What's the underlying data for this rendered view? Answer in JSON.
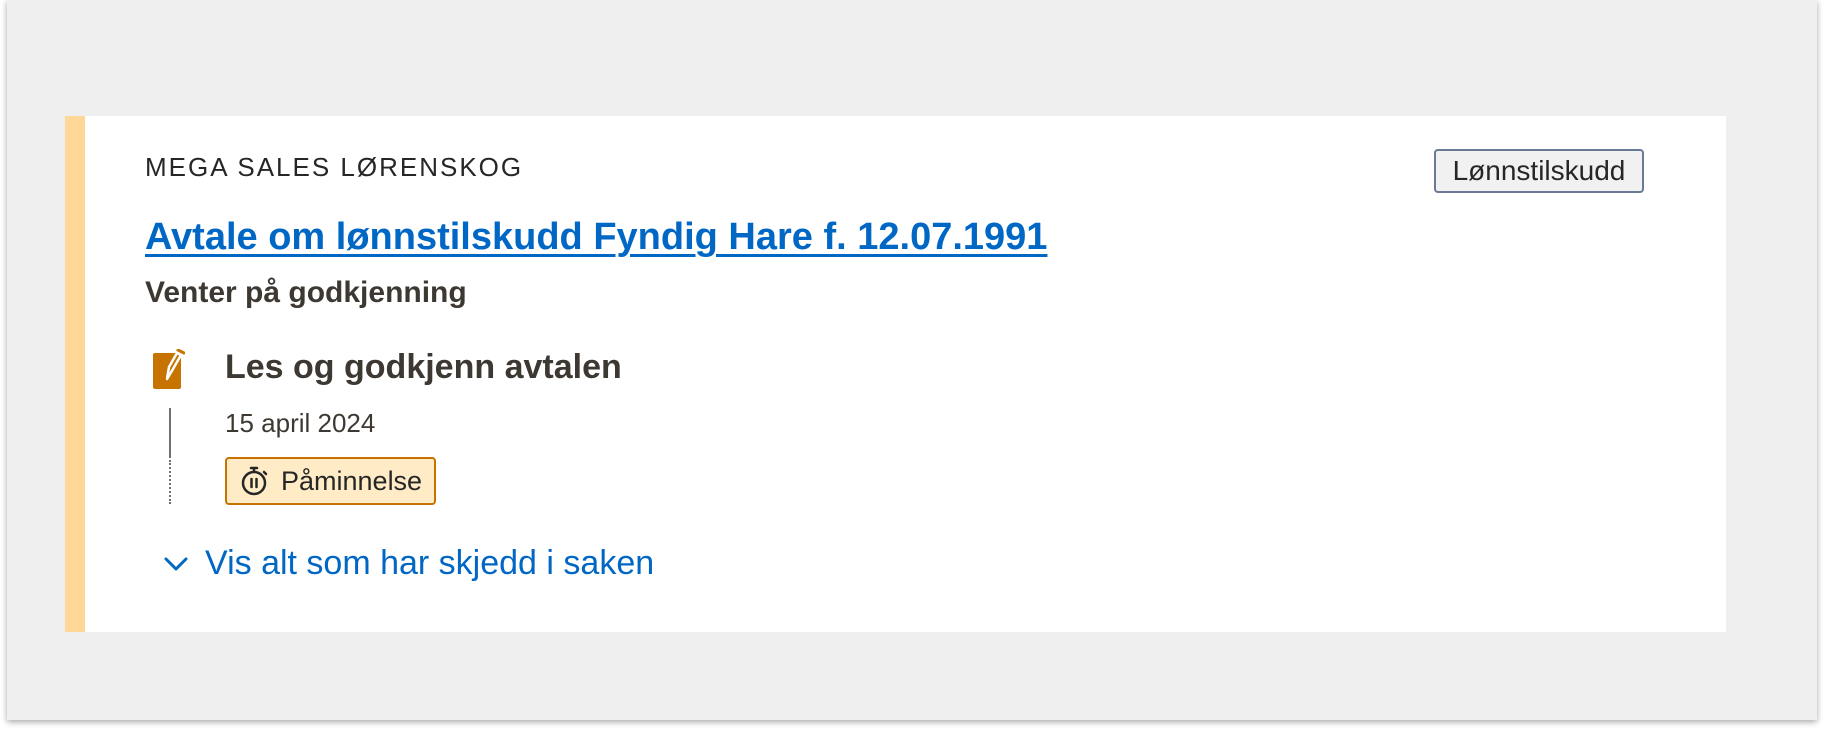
{
  "card": {
    "company": "MEGA SALES LØRENSKOG",
    "type_tag": "Lønnstilskudd",
    "title": "Avtale om lønnstilskudd Fyndig Hare f. 12.07.1991",
    "status": "Venter på godkjenning",
    "accent_color": "#ffd799"
  },
  "task": {
    "title": "Les og godkjenn avtalen",
    "date": "15 april 2024",
    "icon": "edit-document-icon",
    "icon_color": "#c77300"
  },
  "reminder": {
    "label": "Påminnelse",
    "icon": "stopwatch-pause-icon"
  },
  "expand": {
    "label": "Vis alt som har skjedd i saken",
    "icon": "chevron-down-icon"
  },
  "colors": {
    "link": "#0067c5",
    "reminder_bg": "#ffecc7",
    "reminder_border": "#c77300"
  }
}
